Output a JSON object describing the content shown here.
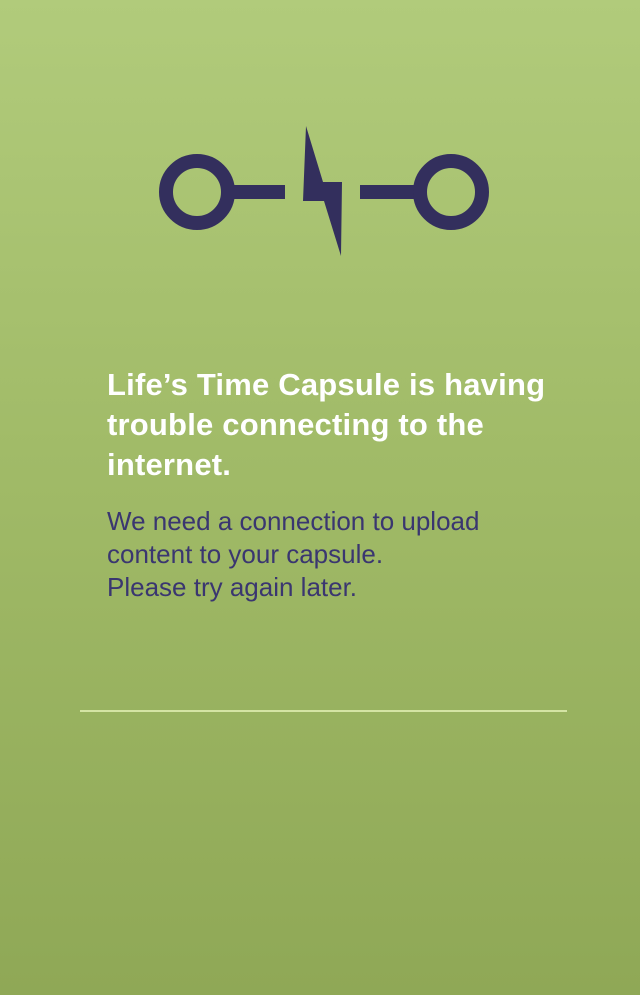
{
  "colors": {
    "background_top": "#b1cb7b",
    "background_bottom": "#8fa856",
    "icon": "#332f5d",
    "title_text": "#ffffff",
    "body_text": "#3a3670",
    "divider": "#d7e7a8"
  },
  "status_icon": {
    "name": "disconnected-plug-icon"
  },
  "error": {
    "title": "Life’s Time Capsule is having trouble connecting to the internet.",
    "body_lines": [
      "We need a connection to upload",
      "content to your capsule.",
      "Please try again later."
    ]
  }
}
